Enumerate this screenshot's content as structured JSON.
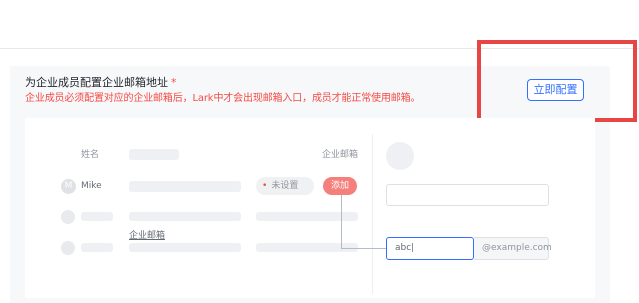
{
  "section": {
    "title": "为企业成员配置企业邮箱地址",
    "required_mark": "*",
    "warning": "企业成员必须配置对应的企业邮箱后，Lark中才会出现邮箱入口，成员才能正常使用邮箱。",
    "configure_button": "立即配置"
  },
  "illustration": {
    "column_name": "姓名",
    "column_email": "企业邮箱",
    "member_initial": "M",
    "member_name": "Mike",
    "status_text": "未设置",
    "status_dot": "•",
    "add_button": "添加",
    "underline_label": "企业邮箱",
    "email_input_value": "abc|",
    "email_suffix": "@example.com"
  },
  "colors": {
    "accent": "#3370ff",
    "warning": "#f54a45",
    "highlight_box": "#e84545"
  }
}
